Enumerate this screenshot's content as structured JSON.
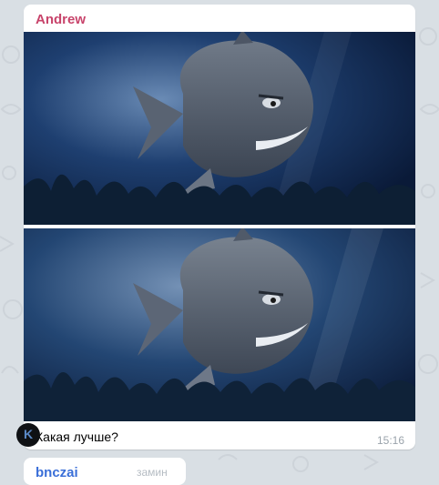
{
  "message": {
    "sender": "Andrew",
    "caption": "Какая лучше?",
    "time": "15:16"
  },
  "next_message": {
    "sender": "bnczai",
    "preview": "замин"
  },
  "colors": {
    "sender": "#c8446b",
    "next_sender": "#3a6fd8",
    "chat_background": "#d9dfe4",
    "bubble": "#ffffff"
  },
  "images": [
    {
      "name": "shark-photo-1",
      "subject": "cartoon shark underwater"
    },
    {
      "name": "shark-photo-2",
      "subject": "cartoon shark underwater"
    }
  ]
}
